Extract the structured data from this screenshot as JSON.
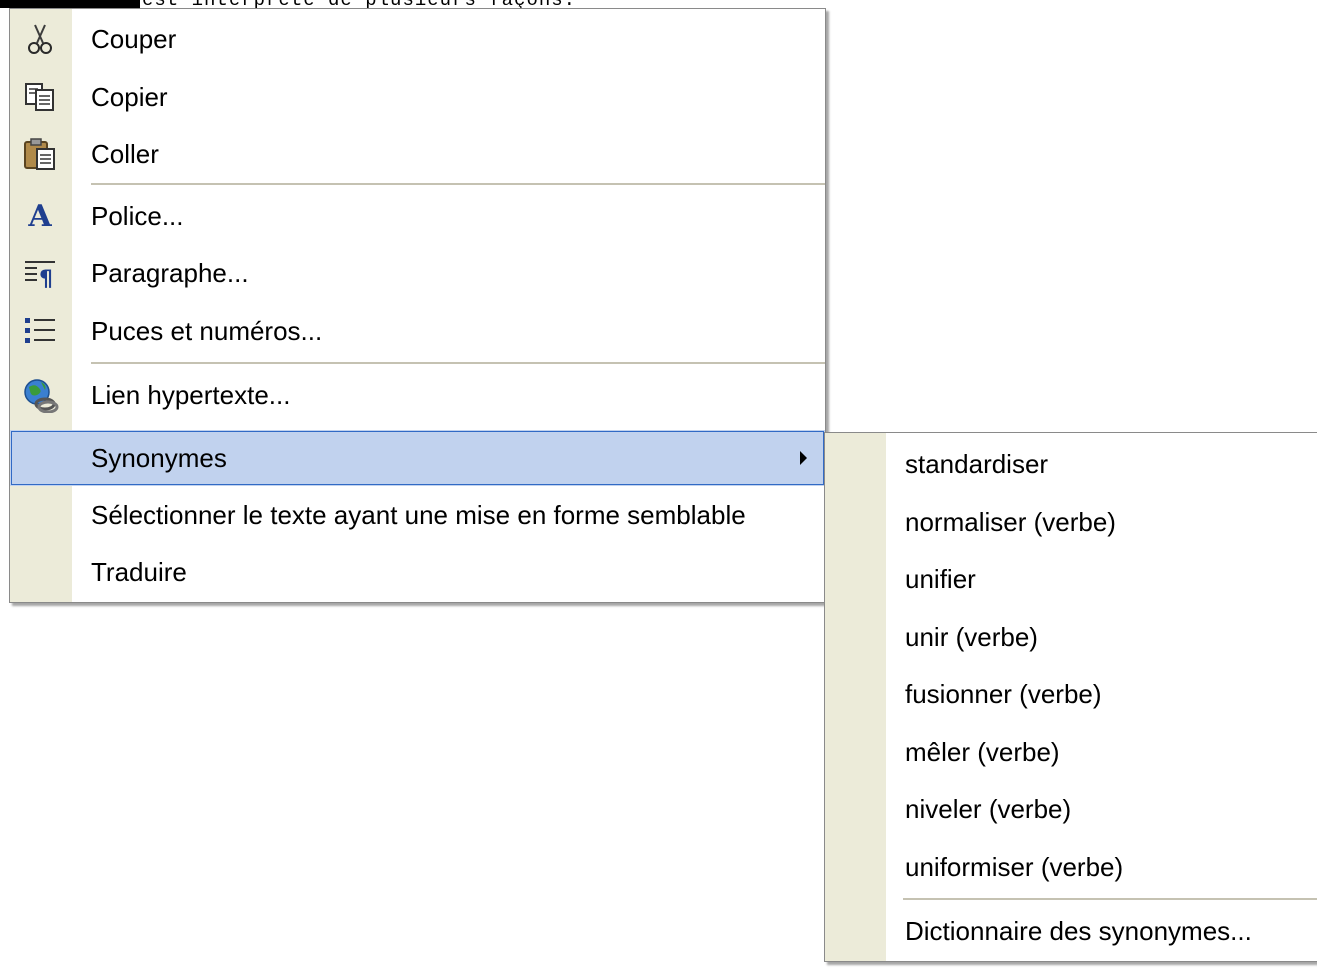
{
  "document": {
    "visible_text": "est interprété de plusieurs façons."
  },
  "context_menu": {
    "items": [
      {
        "label": "Couper",
        "icon": "scissors-icon"
      },
      {
        "label": "Copier",
        "icon": "copy-icon"
      },
      {
        "label": "Coller",
        "icon": "paste-icon"
      },
      {
        "label": "Police...",
        "icon": "font-icon"
      },
      {
        "label": "Paragraphe...",
        "icon": "paragraph-icon"
      },
      {
        "label": "Puces et numéros...",
        "icon": "bullets-icon"
      },
      {
        "label": "Lien hypertexte...",
        "icon": "hyperlink-globe-icon"
      },
      {
        "label": "Synonymes",
        "highlighted": true,
        "has_submenu": true
      },
      {
        "label": "Sélectionner le texte ayant une mise en forme semblable"
      },
      {
        "label": "Traduire"
      }
    ]
  },
  "synonyms_submenu": {
    "items": [
      "standardiser",
      "normaliser (verbe)",
      "unifier",
      "unir (verbe)",
      "fusionner (verbe)",
      "mêler (verbe)",
      "niveler (verbe)",
      "uniformiser (verbe)"
    ],
    "footer": "Dictionnaire des synonymes..."
  },
  "colors": {
    "highlight_bg": "#c1d2ee",
    "highlight_border": "#316ac5",
    "gutter": "#ecebd9",
    "separator": "#c5c2b2"
  }
}
